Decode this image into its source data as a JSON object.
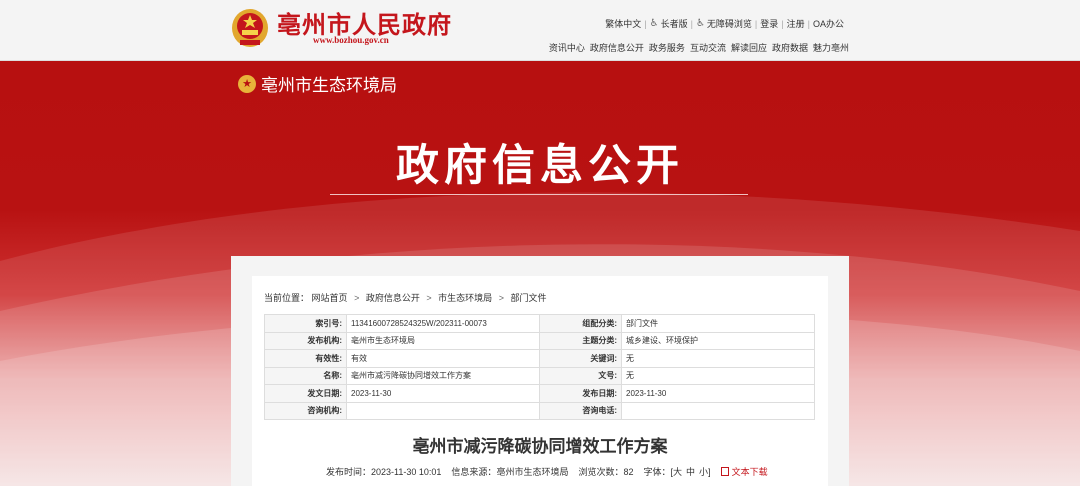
{
  "header": {
    "site_title": "亳州市人民政府",
    "site_url": "www.bozhou.gov.cn",
    "util_links": [
      "繁体中文",
      "长者版",
      "无障碍浏览",
      "登录",
      "注册",
      "OA办公"
    ],
    "main_nav": [
      "资讯中心",
      "政府信息公开",
      "政务服务",
      "互动交流",
      "解读回应",
      "政府数据",
      "魅力亳州"
    ]
  },
  "banner": {
    "department": "亳州市生态环境局",
    "title": "政府信息公开"
  },
  "breadcrumb": {
    "prefix": "当前位置：",
    "items": [
      "网站首页",
      "政府信息公开",
      "市生态环境局",
      "部门文件"
    ]
  },
  "meta_table": [
    [
      "索引号:",
      "11341600728524325W/202311-00073",
      "组配分类:",
      "部门文件"
    ],
    [
      "发布机构:",
      "亳州市生态环境局",
      "主题分类:",
      "城乡建设、环境保护"
    ],
    [
      "有效性:",
      "有效",
      "关键词:",
      "无"
    ],
    [
      "名称:",
      "亳州市减污降碳协同增效工作方案",
      "文号:",
      "无"
    ],
    [
      "发文日期:",
      "2023-11-30",
      "发布日期:",
      "2023-11-30"
    ],
    [
      "咨询机构:",
      "",
      "咨询电话:",
      ""
    ]
  ],
  "document": {
    "title": "亳州市减污降碳协同增效工作方案",
    "publish_time_label": "发布时间：",
    "publish_time": "2023-11-30 10:01",
    "source_label": "信息来源：",
    "source": "亳州市生态环境局",
    "views_label": "浏览次数：",
    "views": "82",
    "font_label": "字体：",
    "font_open": "[",
    "font_large": "大",
    "font_medium": "中",
    "font_small": "小",
    "font_close": "]",
    "download": "文本下载"
  },
  "colors": {
    "brand_red": "#c4161c",
    "banner_red": "#b71010"
  }
}
